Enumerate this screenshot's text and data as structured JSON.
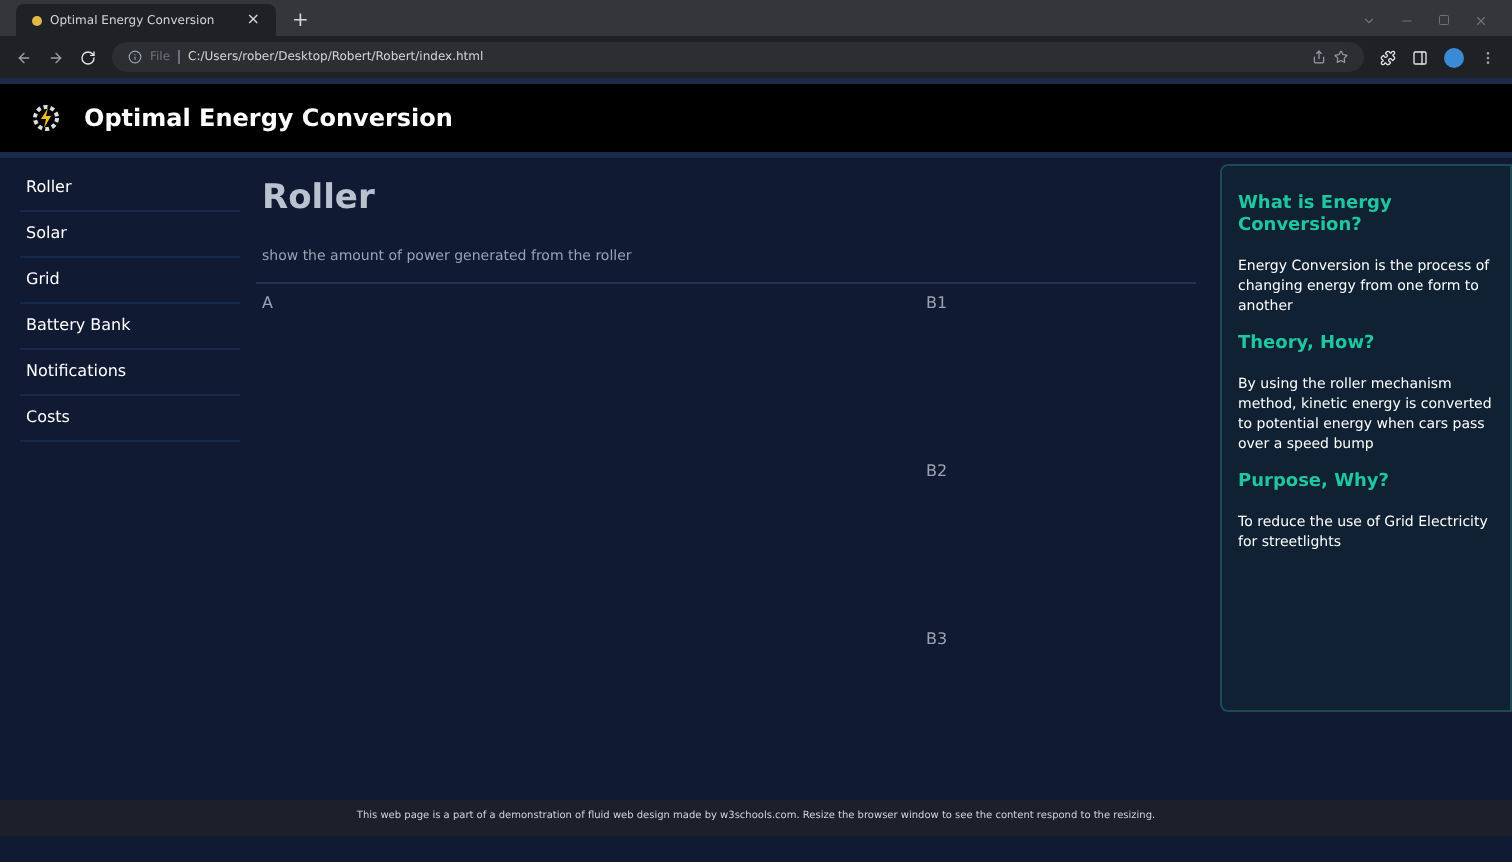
{
  "browser": {
    "tab_title": "Optimal Energy Conversion",
    "close": "×",
    "new_tab": "+",
    "scheme": "File",
    "url": "C:/Users/rober/Desktop/Robert/Robert/index.html"
  },
  "header": {
    "title": "Optimal Energy Conversion"
  },
  "sidebar": {
    "items": [
      "Roller",
      "Solar",
      "Grid",
      "Battery Bank",
      "Notifications",
      "Costs"
    ]
  },
  "main": {
    "title": "Roller",
    "subtitle": "show the amount of power generated from the roller",
    "column_a": "A",
    "column_b": [
      "B1",
      "B2",
      "B3"
    ]
  },
  "aside": {
    "sections": [
      {
        "heading": "What is Energy Conversion?",
        "text": "Energy Conversion is the process of changing energy from one form to another"
      },
      {
        "heading": "Theory, How?",
        "text": "By using the roller mechanism method, kinetic energy is converted to potential energy when cars pass over a speed bump"
      },
      {
        "heading": "Purpose, Why?",
        "text": "To reduce the use of Grid Electricity for streetlights"
      }
    ]
  },
  "footer": {
    "text": "This web page is a part of a demonstration of fluid web design made by w3schools.com. Resize the browser window to see the content respond to the resizing."
  }
}
